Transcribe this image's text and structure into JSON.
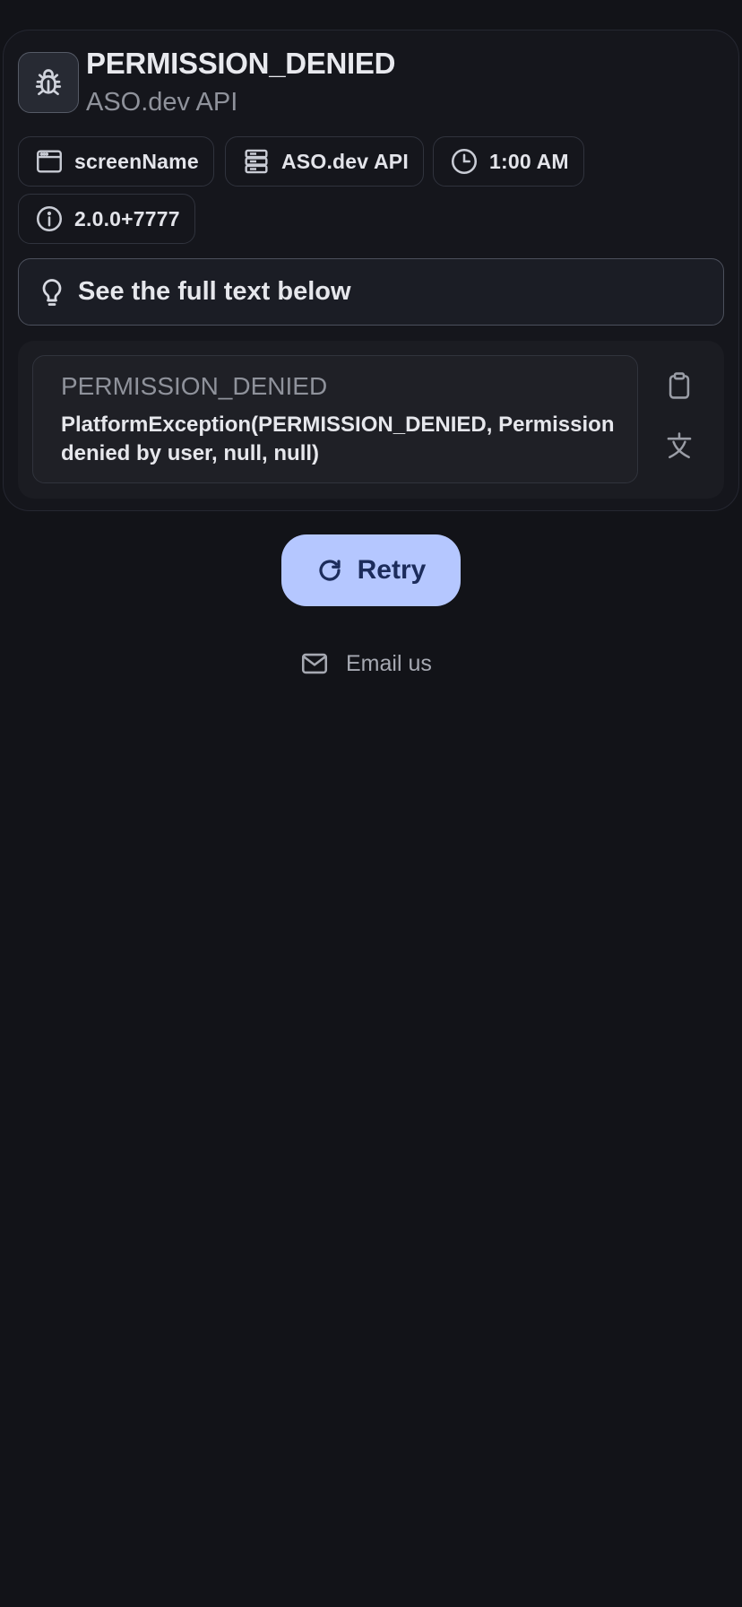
{
  "header": {
    "title": "PERMISSION_DENIED",
    "subtitle": "ASO.dev API",
    "icon": "bug-icon"
  },
  "chips": [
    {
      "icon": "browser-window-icon",
      "label": "screenName"
    },
    {
      "icon": "server-icon",
      "label": "ASO.dev API"
    },
    {
      "icon": "clock-icon",
      "label": "1:00 AM"
    },
    {
      "icon": "info-icon",
      "label": "2.0.0+7777"
    }
  ],
  "hint": {
    "icon": "lightbulb-icon",
    "label": "See the full text below"
  },
  "details": {
    "code": "PERMISSION_DENIED",
    "message": "PlatformException(PERMISSION_DENIED, Permission denied by user, null, null)",
    "copy_icon": "clipboard-icon",
    "translate_icon": "translate-icon"
  },
  "actions": {
    "retry_label": "Retry",
    "email_label": "Email us"
  },
  "colors": {
    "background": "#121318",
    "accent": "#b5c7ff",
    "accent_text": "#1c2c5b"
  }
}
